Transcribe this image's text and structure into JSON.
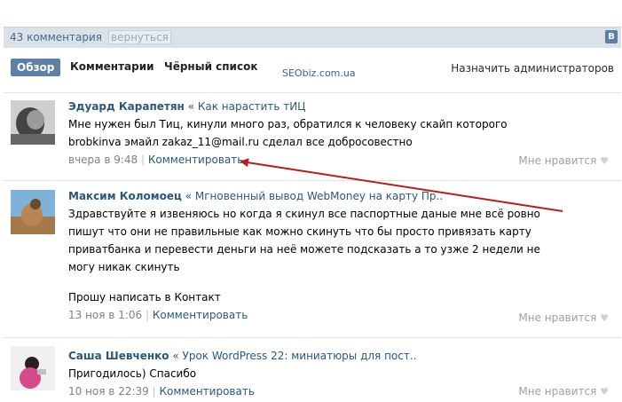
{
  "header": {
    "count_label": "43 комментария",
    "back_label": "вернуться",
    "logo_letter": "B"
  },
  "tabs": {
    "overview": "Обзор",
    "comments": "Комментарии",
    "blacklist": "Чёрный список",
    "assign_admins": "Назначить администраторов"
  },
  "watermark": "SEObiz.com.ua",
  "like_label": "Мне нравится",
  "reply_label": "Комментировать",
  "colors": {
    "accent": "#5e80a9",
    "link": "#2b587a",
    "arrow": "#b91c1c"
  },
  "comments": [
    {
      "author": "Эдуард Карапетян",
      "topic": "« Как нарастить тИЦ",
      "text1": "Мне нужен был Тиц, кинули много раз, обратился к человеку скайп которого",
      "text2": "brobkinva эмайл zakaz_11@mail.ru сделал все добросовестно",
      "time": "вчера в 9:48"
    },
    {
      "author": "Максим Коломоец",
      "topic": "« Мгновенный вывод WebMoney на карту Пр..",
      "text1": "Здравствуйте я извеняюсь но когда я скинул все паспортные даные мне всё ровно",
      "text2": "пишут что они не правильные как можно скинуть что бы просто привязать карту",
      "text3": "приватбанка и перевести деньги на неё можете подсказать а то узже 2 недели не",
      "text4": "могу никак скинуть",
      "text5": "Прошу написать в Контакт",
      "time": "13 ноя в 1:06"
    },
    {
      "author": "Саша Шевченко",
      "topic": "« Урок WordPress 22: миниатюры для пост..",
      "text1": "Пригодилось) Спасибо",
      "time": "10 ноя в 22:39"
    }
  ]
}
